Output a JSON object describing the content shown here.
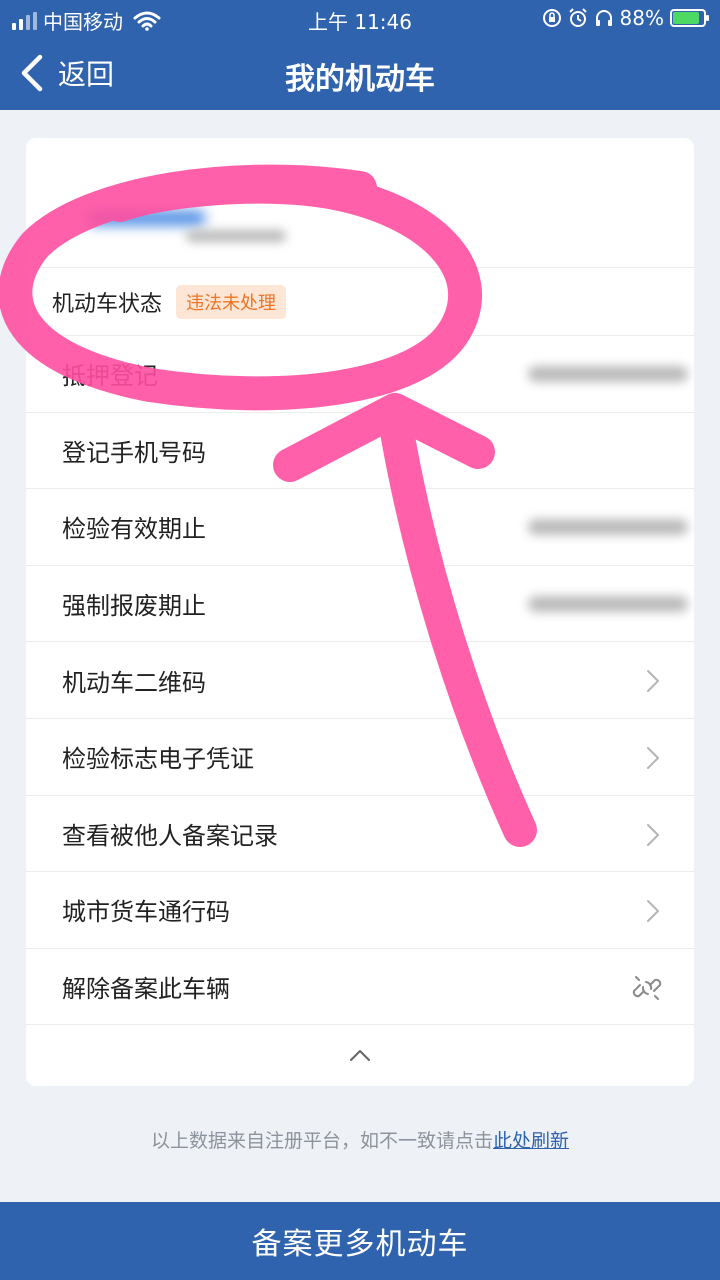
{
  "status_bar": {
    "carrier": "中国移动",
    "time": "上午 11:46",
    "battery_percent_text": "88%",
    "battery_level": 0.88
  },
  "nav": {
    "back_label": "返回",
    "title": "我的机动车"
  },
  "vehicle": {
    "status_label": "机动车状态",
    "status_badge": "违法未处理",
    "rows": [
      {
        "label": "抵押登记",
        "type": "value-hidden"
      },
      {
        "label": "登记手机号码",
        "type": "plain"
      },
      {
        "label": "检验有效期止",
        "type": "value-hidden"
      },
      {
        "label": "强制报废期止",
        "type": "value-hidden"
      },
      {
        "label": "机动车二维码",
        "type": "link"
      },
      {
        "label": "检验标志电子凭证",
        "type": "link"
      },
      {
        "label": "查看被他人备案记录",
        "type": "link"
      },
      {
        "label": "城市货车通行码",
        "type": "link"
      },
      {
        "label": "解除备案此车辆",
        "type": "unlink"
      }
    ]
  },
  "footnote": {
    "text": "以上数据来自注册平台，如不一致请点击",
    "link": "此处刷新"
  },
  "bottom_button": "备案更多机动车",
  "colors": {
    "primary": "#2f63ad",
    "badge_bg": "#fde6d6",
    "badge_text": "#f07422",
    "annotation": "#ff4fa0"
  },
  "icons": [
    "back-chevron-icon",
    "wifi-icon",
    "alarm-icon",
    "headphones-icon",
    "battery-icon",
    "chevron-right-icon",
    "unlink-icon",
    "chevron-up-icon"
  ]
}
